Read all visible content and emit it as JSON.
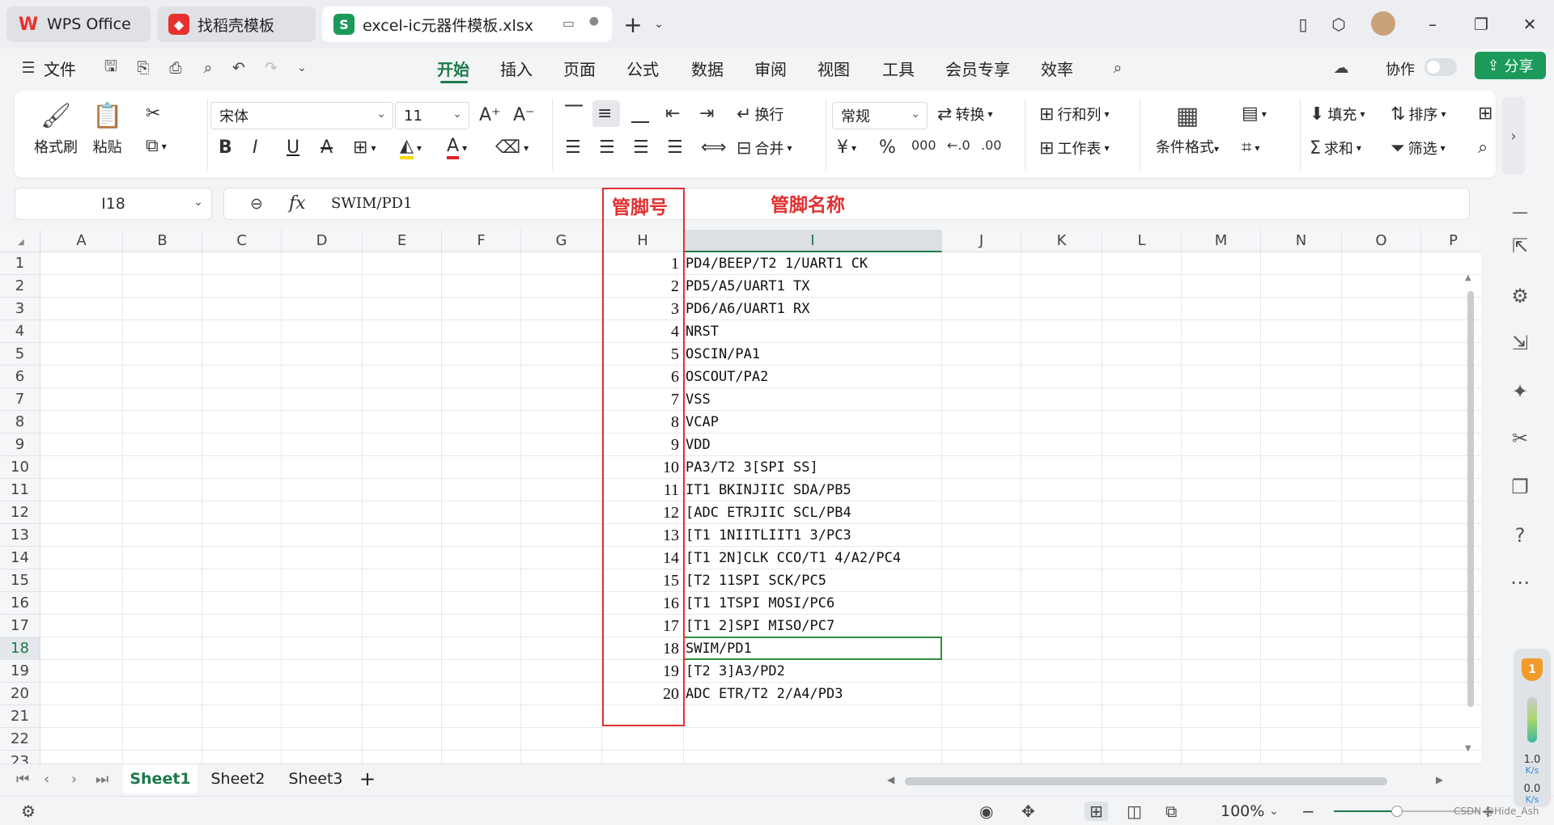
{
  "titlebar": {
    "tabs": [
      {
        "label": "WPS Office",
        "icon": "wps-logo-icon",
        "color": "#e8312d"
      },
      {
        "label": "找稻壳模板",
        "icon": "docer-icon",
        "color": "#e8312d"
      },
      {
        "label": "excel-ic元器件模板.xlsx",
        "icon": "spreadsheet-icon",
        "color": "#1b9a5a"
      }
    ],
    "new_tab": "+"
  },
  "menubar": {
    "file_label": "文件",
    "items": [
      "开始",
      "插入",
      "页面",
      "公式",
      "数据",
      "审阅",
      "视图",
      "工具",
      "会员专享",
      "效率"
    ],
    "active": "开始",
    "collab_label": "协作",
    "share_label": "分享"
  },
  "ribbon": {
    "format_painter": "格式刷",
    "paste": "粘贴",
    "font_name": "宋体",
    "font_size": "11",
    "wrap": "换行",
    "merge": "合并",
    "number_format": "常规",
    "convert": "转换",
    "rows_cols": "行和列",
    "worksheet": "工作表",
    "cond_format": "条件格式",
    "fill": "填充",
    "sort": "排序",
    "sum": "求和",
    "filter": "筛选",
    "font_color": "#e02020",
    "highlight_color": "#f5d800"
  },
  "formula": {
    "namebox": "I18",
    "fx": "fx",
    "value": "SWIM/PD1"
  },
  "grid": {
    "columns": [
      "A",
      "B",
      "C",
      "D",
      "E",
      "F",
      "G",
      "H",
      "I",
      "J",
      "K",
      "L",
      "M",
      "N",
      "O",
      "P"
    ],
    "rows": [
      "1",
      "2",
      "3",
      "4",
      "5",
      "6",
      "7",
      "8",
      "9",
      "10",
      "11",
      "12",
      "13",
      "14",
      "15",
      "16",
      "17",
      "18",
      "19",
      "20",
      "21",
      "22",
      "23"
    ],
    "selected_col": "I",
    "selected_row": "18",
    "pin_numbers": [
      "1",
      "2",
      "3",
      "4",
      "5",
      "6",
      "7",
      "8",
      "9",
      "10",
      "11",
      "12",
      "13",
      "14",
      "15",
      "16",
      "17",
      "18",
      "19",
      "20"
    ],
    "pin_names": [
      "PD4/BEEP/T2 1/UART1 CK",
      "PD5/A5/UART1 TX",
      "PD6/A6/UART1 RX",
      "NRST",
      "OSCIN/PA1",
      "OSCOUT/PA2",
      "VSS",
      "VCAP",
      "VDD",
      "PA3/T2 3[SPI SS]",
      "IT1 BKINJIIC SDA/PB5",
      "[ADC ETRJIIC SCL/PB4",
      "[T1 1NIITLIIT1 3/PC3",
      "[T1 2N]CLK CCO/T1 4/A2/PC4",
      "[T2 11SPI SCK/PC5",
      "[T1 1TSPI MOSI/PC6",
      "[T1 2]SPI MISO/PC7",
      "SWIM/PD1",
      "[T2 3]A3/PD2",
      "ADC ETR/T2 2/A4/PD3"
    ]
  },
  "annotations": {
    "pin_number_label": "管脚号",
    "pin_name_label": "管脚名称",
    "color": "#e03030"
  },
  "sheets": {
    "tabs": [
      "Sheet1",
      "Sheet2",
      "Sheet3"
    ],
    "active": "Sheet1",
    "add": "+"
  },
  "status": {
    "zoom": "100%"
  },
  "widget": {
    "badge": "1",
    "up_speed": "1.0",
    "up_unit": "K/s",
    "down_speed": "0.0",
    "down_unit": "K/s"
  },
  "watermark": "CSDN @Hide_Ash"
}
